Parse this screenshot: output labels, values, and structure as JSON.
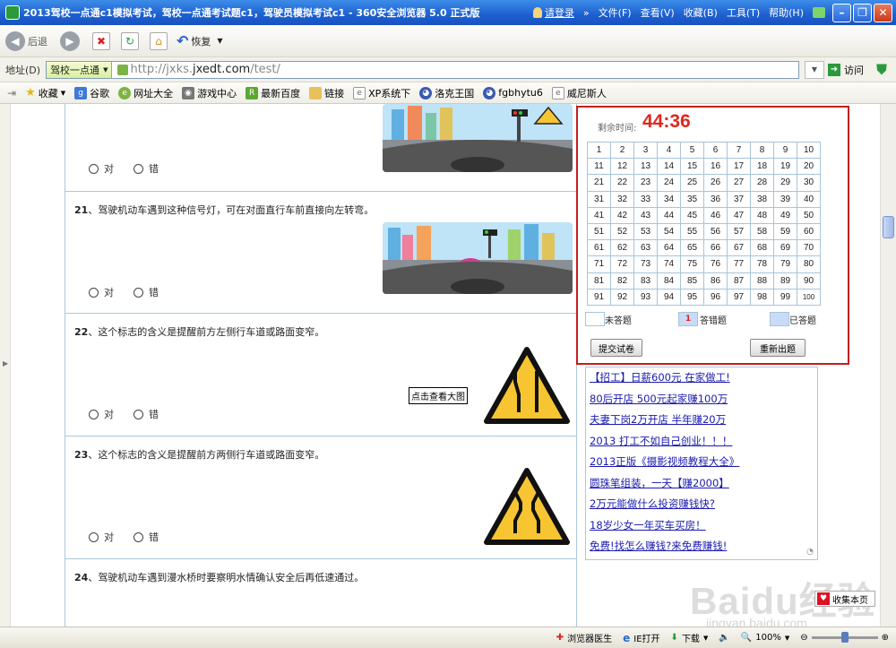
{
  "window": {
    "title": "2013驾校一点通c1模拟考试，驾校一点通考试题c1，驾驶员模拟考试c1 - 360安全浏览器 5.0 正式版",
    "login": "请登录",
    "menu": [
      "文件(F)",
      "查看(V)",
      "收藏(B)",
      "工具(T)",
      "帮助(H)"
    ]
  },
  "toolbar": {
    "back": "后退",
    "restore": "恢复"
  },
  "address": {
    "label": "地址(D)",
    "site_name": "驾校一点通",
    "url_prefix": "http://jxks.",
    "url_domain": "jxedt.com",
    "url_path": "/test/",
    "visit": "访问"
  },
  "favorites": [
    "收藏",
    "谷歌",
    "网址大全",
    "游戏中心",
    "最新百度",
    "链接",
    "XP系统下",
    "洛克王国",
    "fgbhytu6",
    "威尼斯人"
  ],
  "questions": [
    {
      "number": "",
      "text": "",
      "true_label": "对",
      "false_label": "错"
    },
    {
      "number": "21",
      "text": "驾驶机动车遇到这种信号灯，可在对面直行车前直接向左转弯。",
      "true_label": "对",
      "false_label": "错"
    },
    {
      "number": "22",
      "text": "这个标志的含义是提醒前方左侧行车道或路面变窄。",
      "true_label": "对",
      "false_label": "错"
    },
    {
      "number": "23",
      "text": "这个标志的含义是提醒前方两侧行车道或路面变窄。",
      "true_label": "对",
      "false_label": "错"
    },
    {
      "number": "24",
      "text": "驾驶机动车遇到漫水桥时要察明水情确认安全后再低速通过。"
    }
  ],
  "separator": "、",
  "tooltip": "点击查看大图",
  "panel": {
    "timer_label": "剩余时间:",
    "timer_value": "44:36",
    "grid": [
      [
        "1",
        "2",
        "3",
        "4",
        "5",
        "6",
        "7",
        "8",
        "9",
        "10"
      ],
      [
        "11",
        "12",
        "13",
        "14",
        "15",
        "16",
        "17",
        "18",
        "19",
        "20"
      ],
      [
        "21",
        "22",
        "23",
        "24",
        "25",
        "26",
        "27",
        "28",
        "29",
        "30"
      ],
      [
        "31",
        "32",
        "33",
        "34",
        "35",
        "36",
        "37",
        "38",
        "39",
        "40"
      ],
      [
        "41",
        "42",
        "43",
        "44",
        "45",
        "46",
        "47",
        "48",
        "49",
        "50"
      ],
      [
        "51",
        "52",
        "53",
        "54",
        "55",
        "56",
        "57",
        "58",
        "59",
        "60"
      ],
      [
        "61",
        "62",
        "63",
        "64",
        "65",
        "66",
        "67",
        "68",
        "69",
        "70"
      ],
      [
        "71",
        "72",
        "73",
        "74",
        "75",
        "76",
        "77",
        "78",
        "79",
        "80"
      ],
      [
        "81",
        "82",
        "83",
        "84",
        "85",
        "86",
        "87",
        "88",
        "89",
        "90"
      ],
      [
        "91",
        "92",
        "93",
        "94",
        "95",
        "96",
        "97",
        "98",
        "99",
        "100"
      ]
    ],
    "legend_unanswered": "未答题",
    "legend_wrong_mark": "1",
    "legend_wrong": "答错题",
    "legend_answered": "已答题",
    "submit": "提交试卷",
    "restart": "重新出题",
    "colors": {
      "border": "#c31e1e",
      "timer": "#e0261d",
      "answered": "#c9dbf7",
      "wrong": "#c9dbf7"
    }
  },
  "ads": [
    "【招工】日薪600元 在家做工!",
    "80后开店 500元起家赚100万",
    "夫妻下岗2万开店 半年赚20万",
    "2013 打工不如自己创业！！！",
    "2013正版《摄影视频教程大全》",
    "圆珠笔组装，一天【赚2000】",
    "2万元能做什么投资赚钱快?",
    "18岁少女一年买车买房！",
    "免费!找怎么赚钱?来免费赚钱!"
  ],
  "watermark": {
    "main": "Baidu经验",
    "sub": "jingyan.baidu.com"
  },
  "favorite_page": "收集本页",
  "statusbar": {
    "doctor": "浏览器医生",
    "ie_open": "IE打开",
    "download": "下载",
    "zoom": "100%"
  }
}
